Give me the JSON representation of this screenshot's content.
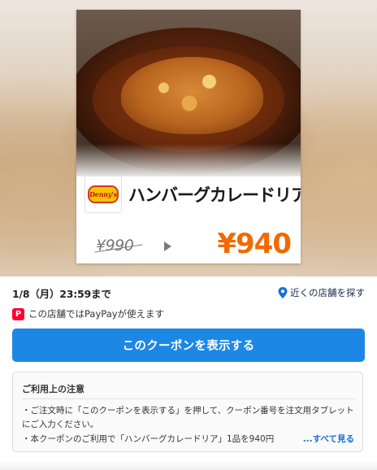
{
  "coupon": {
    "brand_logo_text": "Denny's",
    "menu_name": "ハンバーグカレードリア",
    "original_price": "¥990",
    "discount_price": "¥940"
  },
  "info": {
    "expiry": "1/8（月）23:59まで",
    "nearby_stores": "近くの店舗を探す",
    "paypay_notice": "この店舗ではPayPayが使えます",
    "paypay_icon_letter": "P"
  },
  "action": {
    "show_coupon_label": "このクーポンを表示する"
  },
  "notes": {
    "title": "ご利用上の注意",
    "items": [
      "・ご注文時に「このクーポンを表示する」を押して、クーポン番号を注文用タブレットにご入力ください。",
      "・本クーポンのご利用で「ハンバーグカレードリア」1品を940円"
    ],
    "more_label": "...すべて見る"
  },
  "colors": {
    "accent_blue": "#1d87e5",
    "price_orange": "#f06a00",
    "paypay_red": "#ff0033"
  }
}
